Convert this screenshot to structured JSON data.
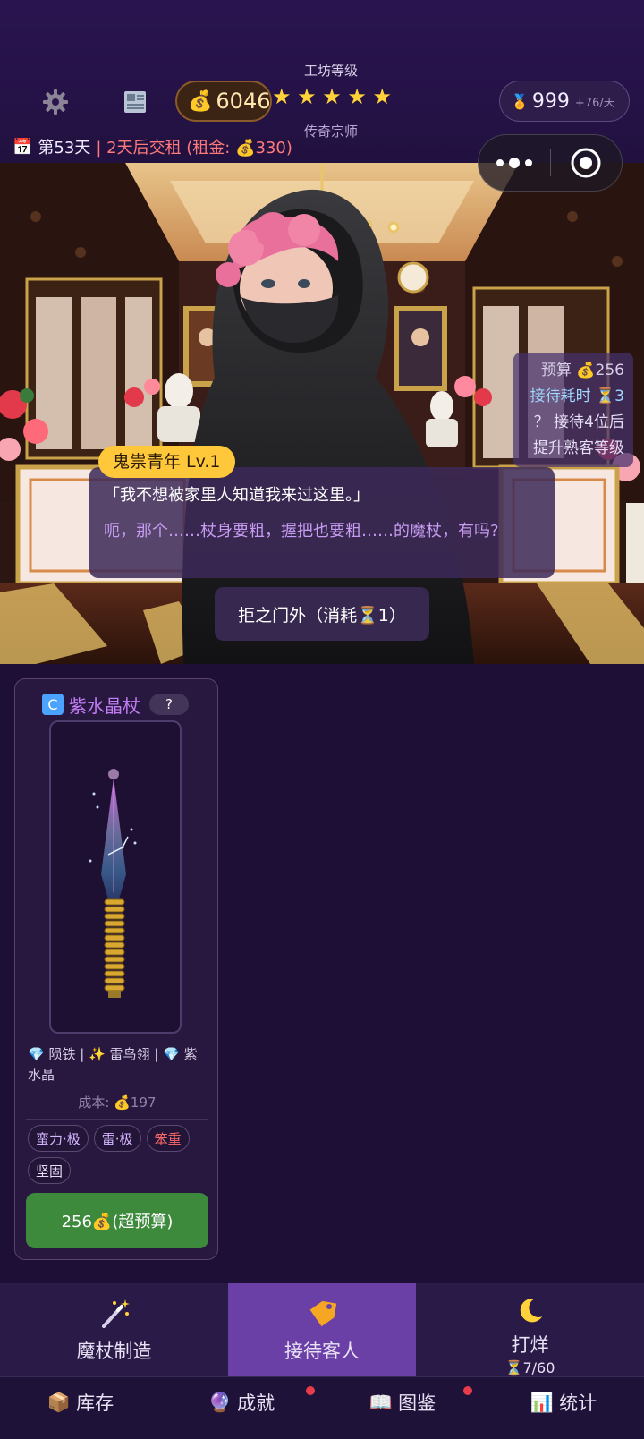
{
  "header": {
    "coins": "6046",
    "level_title": "工坊等级",
    "level_name": "传奇宗师",
    "stars": [
      "★",
      "★",
      "★",
      "★",
      "★"
    ],
    "medals": "999",
    "medal_rate": "+76/天",
    "day": "第53天",
    "rent_notice": "| 2天后交租 (租金: 💰330)"
  },
  "customer": {
    "name_tag": "鬼祟青年 Lv.1",
    "quote": "「我不想被家里人知道我来过这里。」",
    "speech": "呃，那个……杖身要粗，握把也要粗……的魔杖，有吗?",
    "budget": "预算 💰256",
    "time_cost": "接待耗时 ⏳3",
    "hint_line1": "？ 接待4位后",
    "hint_line2": "提升熟客等级",
    "reject_button": "拒之门外（消耗⏳1）"
  },
  "item": {
    "rarity": "C",
    "name": "紫水晶杖",
    "question": "?",
    "materials": "💎 陨铁 | ✨ 雷鸟翎 | 💎 紫水晶",
    "cost": "成本: 💰197",
    "tags": [
      {
        "label": "蛮力·极",
        "style": "purple"
      },
      {
        "label": "雷·极",
        "style": "purple"
      },
      {
        "label": "笨重",
        "style": "red"
      },
      {
        "label": "坚固",
        "style": "plain"
      }
    ],
    "buy_button": "256💰(超预算)"
  },
  "nav": {
    "tabs": [
      {
        "label": "魔杖制造",
        "icon": "magic-wand-icon"
      },
      {
        "label": "接待客人",
        "icon": "price-tag-icon",
        "active": true
      },
      {
        "label": "打烊",
        "icon": "crescent-moon-icon",
        "sub": "⏳7/60"
      }
    ],
    "secondary": [
      {
        "label": "库存",
        "icon": "package-icon"
      },
      {
        "label": "成就",
        "icon": "crystal-ball-icon",
        "badge": true
      },
      {
        "label": "图鉴",
        "icon": "open-book-icon",
        "badge": true
      },
      {
        "label": "统计",
        "icon": "bar-chart-icon"
      }
    ]
  },
  "colors": {
    "background": "#1d0f35",
    "accent_active_tab": "#6a3fa6",
    "gold": "#ffc83a",
    "buy_green": "#3d8a3d",
    "warning_red": "#ff7a7a"
  }
}
